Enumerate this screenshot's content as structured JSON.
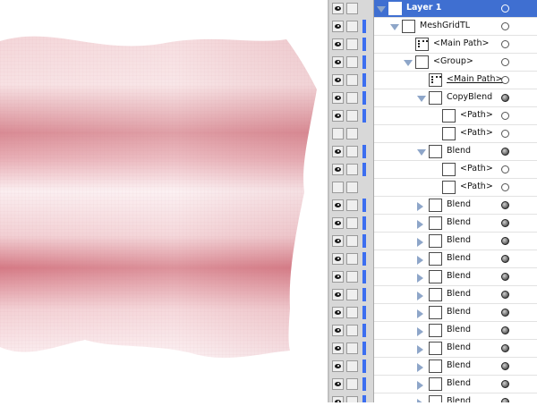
{
  "layers": [
    {
      "label": "Layer 1",
      "selected": true,
      "eye": true,
      "colorbar": false,
      "arrow": "down",
      "indent": 0,
      "thumb": "plain",
      "target": "hollow",
      "underline": false
    },
    {
      "label": "MeshGridTL",
      "eye": true,
      "colorbar": true,
      "arrow": "down",
      "indent": 1,
      "thumb": "plain",
      "target": "hollow",
      "underline": false
    },
    {
      "label": "<Main Path>",
      "eye": true,
      "colorbar": true,
      "arrow": "none",
      "indent": 2,
      "thumb": "mainpath",
      "target": "hollow",
      "underline": false
    },
    {
      "label": "<Group>",
      "eye": true,
      "colorbar": true,
      "arrow": "down",
      "indent": 2,
      "thumb": "plain",
      "target": "hollow",
      "underline": false
    },
    {
      "label": "<Main Path>",
      "eye": true,
      "colorbar": true,
      "arrow": "none",
      "indent": 3,
      "thumb": "mainpath",
      "target": "hollow",
      "underline": true
    },
    {
      "label": "CopyBlend",
      "eye": true,
      "colorbar": true,
      "arrow": "down",
      "indent": 3,
      "thumb": "plain",
      "target": "filled",
      "underline": false
    },
    {
      "label": "<Path>",
      "eye": true,
      "colorbar": true,
      "arrow": "none",
      "indent": 4,
      "thumb": "plain",
      "target": "hollow",
      "underline": false
    },
    {
      "label": "<Path>",
      "eye": false,
      "colorbar": false,
      "arrow": "none",
      "indent": 4,
      "thumb": "plain",
      "target": "hollow",
      "underline": false
    },
    {
      "label": "Blend",
      "eye": true,
      "colorbar": true,
      "arrow": "down",
      "indent": 3,
      "thumb": "plain",
      "target": "filled",
      "underline": false
    },
    {
      "label": "<Path>",
      "eye": true,
      "colorbar": true,
      "arrow": "none",
      "indent": 4,
      "thumb": "plain",
      "target": "hollow",
      "underline": false
    },
    {
      "label": "<Path>",
      "eye": false,
      "colorbar": false,
      "arrow": "none",
      "indent": 4,
      "thumb": "plain",
      "target": "hollow",
      "underline": false
    },
    {
      "label": "Blend",
      "eye": true,
      "colorbar": true,
      "arrow": "right",
      "indent": 3,
      "thumb": "plain",
      "target": "filled",
      "underline": false
    },
    {
      "label": "Blend",
      "eye": true,
      "colorbar": true,
      "arrow": "right",
      "indent": 3,
      "thumb": "plain",
      "target": "filled",
      "underline": false
    },
    {
      "label": "Blend",
      "eye": true,
      "colorbar": true,
      "arrow": "right",
      "indent": 3,
      "thumb": "plain",
      "target": "filled",
      "underline": false
    },
    {
      "label": "Blend",
      "eye": true,
      "colorbar": true,
      "arrow": "right",
      "indent": 3,
      "thumb": "plain",
      "target": "filled",
      "underline": false
    },
    {
      "label": "Blend",
      "eye": true,
      "colorbar": true,
      "arrow": "right",
      "indent": 3,
      "thumb": "plain",
      "target": "filled",
      "underline": false
    },
    {
      "label": "Blend",
      "eye": true,
      "colorbar": true,
      "arrow": "right",
      "indent": 3,
      "thumb": "plain",
      "target": "filled",
      "underline": false
    },
    {
      "label": "Blend",
      "eye": true,
      "colorbar": true,
      "arrow": "right",
      "indent": 3,
      "thumb": "plain",
      "target": "filled",
      "underline": false
    },
    {
      "label": "Blend",
      "eye": true,
      "colorbar": true,
      "arrow": "right",
      "indent": 3,
      "thumb": "plain",
      "target": "filled",
      "underline": false
    },
    {
      "label": "Blend",
      "eye": true,
      "colorbar": true,
      "arrow": "right",
      "indent": 3,
      "thumb": "plain",
      "target": "filled",
      "underline": false
    },
    {
      "label": "Blend",
      "eye": true,
      "colorbar": true,
      "arrow": "right",
      "indent": 3,
      "thumb": "plain",
      "target": "filled",
      "underline": false
    },
    {
      "label": "Blend",
      "eye": true,
      "colorbar": true,
      "arrow": "right",
      "indent": 3,
      "thumb": "plain",
      "target": "filled",
      "underline": false
    },
    {
      "label": "Blend",
      "eye": true,
      "colorbar": true,
      "arrow": "right",
      "indent": 3,
      "thumb": "plain",
      "target": "filled",
      "underline": false
    }
  ],
  "colors": {
    "selection": "#3f6fd1",
    "layer_color": "#3c6ef0",
    "mesh_base": "#f0c8cc",
    "mesh_shadow": "#d67f89",
    "mesh_highlight": "#fbeef0"
  }
}
